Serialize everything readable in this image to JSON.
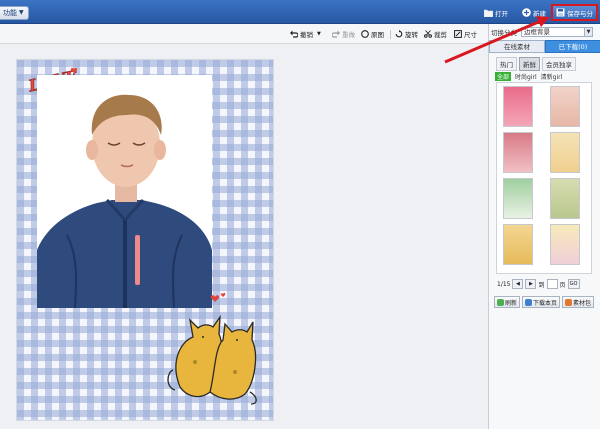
{
  "top_bar": {
    "menu_label": "功能",
    "open_label": "打开",
    "new_label": "新建",
    "save_label": "保存与分"
  },
  "toolbar": {
    "undo_label": "撤销",
    "redo_label": "重做",
    "original_label": "原图",
    "rotate_label": "旋转",
    "crop_label": "裁剪",
    "size_label": "尺寸"
  },
  "panel": {
    "category_label": "切换分类",
    "category_value": "边框背景",
    "tabs": [
      "在线素材",
      "已下载(0)"
    ],
    "subtabs": [
      "热门",
      "新鲜",
      "会员独享"
    ],
    "filters": [
      "全部",
      "时尚girl",
      "清新girl"
    ],
    "pager": {
      "page_text": "1/15",
      "goto_prefix": "到",
      "goto_suffix": "页",
      "go_label": "GO"
    },
    "bottom_buttons": [
      "刷新",
      "下载本页",
      "素材包"
    ]
  },
  "canvas": {
    "love_text": "LOVE"
  },
  "colors": {
    "title_bar": "#2f64b0",
    "accent_blue": "#3f8fe0",
    "annotation_red": "#d7191f",
    "gingham": "#96aad7"
  }
}
